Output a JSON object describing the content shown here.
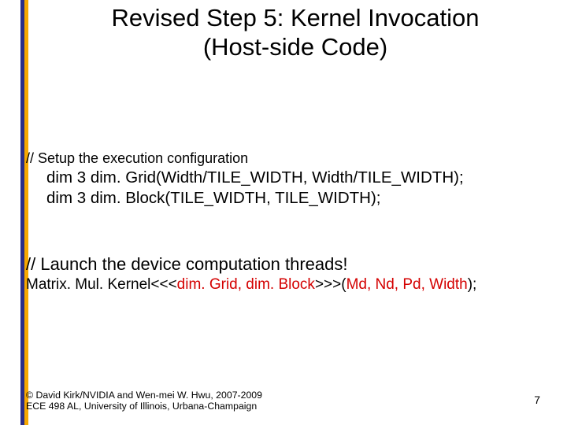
{
  "title": {
    "line1": "Revised Step 5: Kernel Invocation",
    "line2": "(Host-side Code)"
  },
  "comment1": "// Setup the execution configuration",
  "code": {
    "line1": "dim 3 dim. Grid(Width/TILE_WIDTH, Width/TILE_WIDTH);",
    "line2": " dim 3 dim. Block(TILE_WIDTH, TILE_WIDTH);"
  },
  "comment2": "// Launch the device computation threads!",
  "kernel": {
    "p1": "Matrix. Mul. Kernel<<<",
    "p2": "dim. Grid, dim. Block",
    "p3": ">>>(",
    "p4": "Md, Nd, Pd, Width",
    "p5": ");"
  },
  "footer": {
    "line1": "© David Kirk/NVIDIA and Wen-mei W. Hwu, 2007-2009",
    "line2": "ECE 498 AL, University of Illinois, Urbana-Champaign"
  },
  "page": "7"
}
